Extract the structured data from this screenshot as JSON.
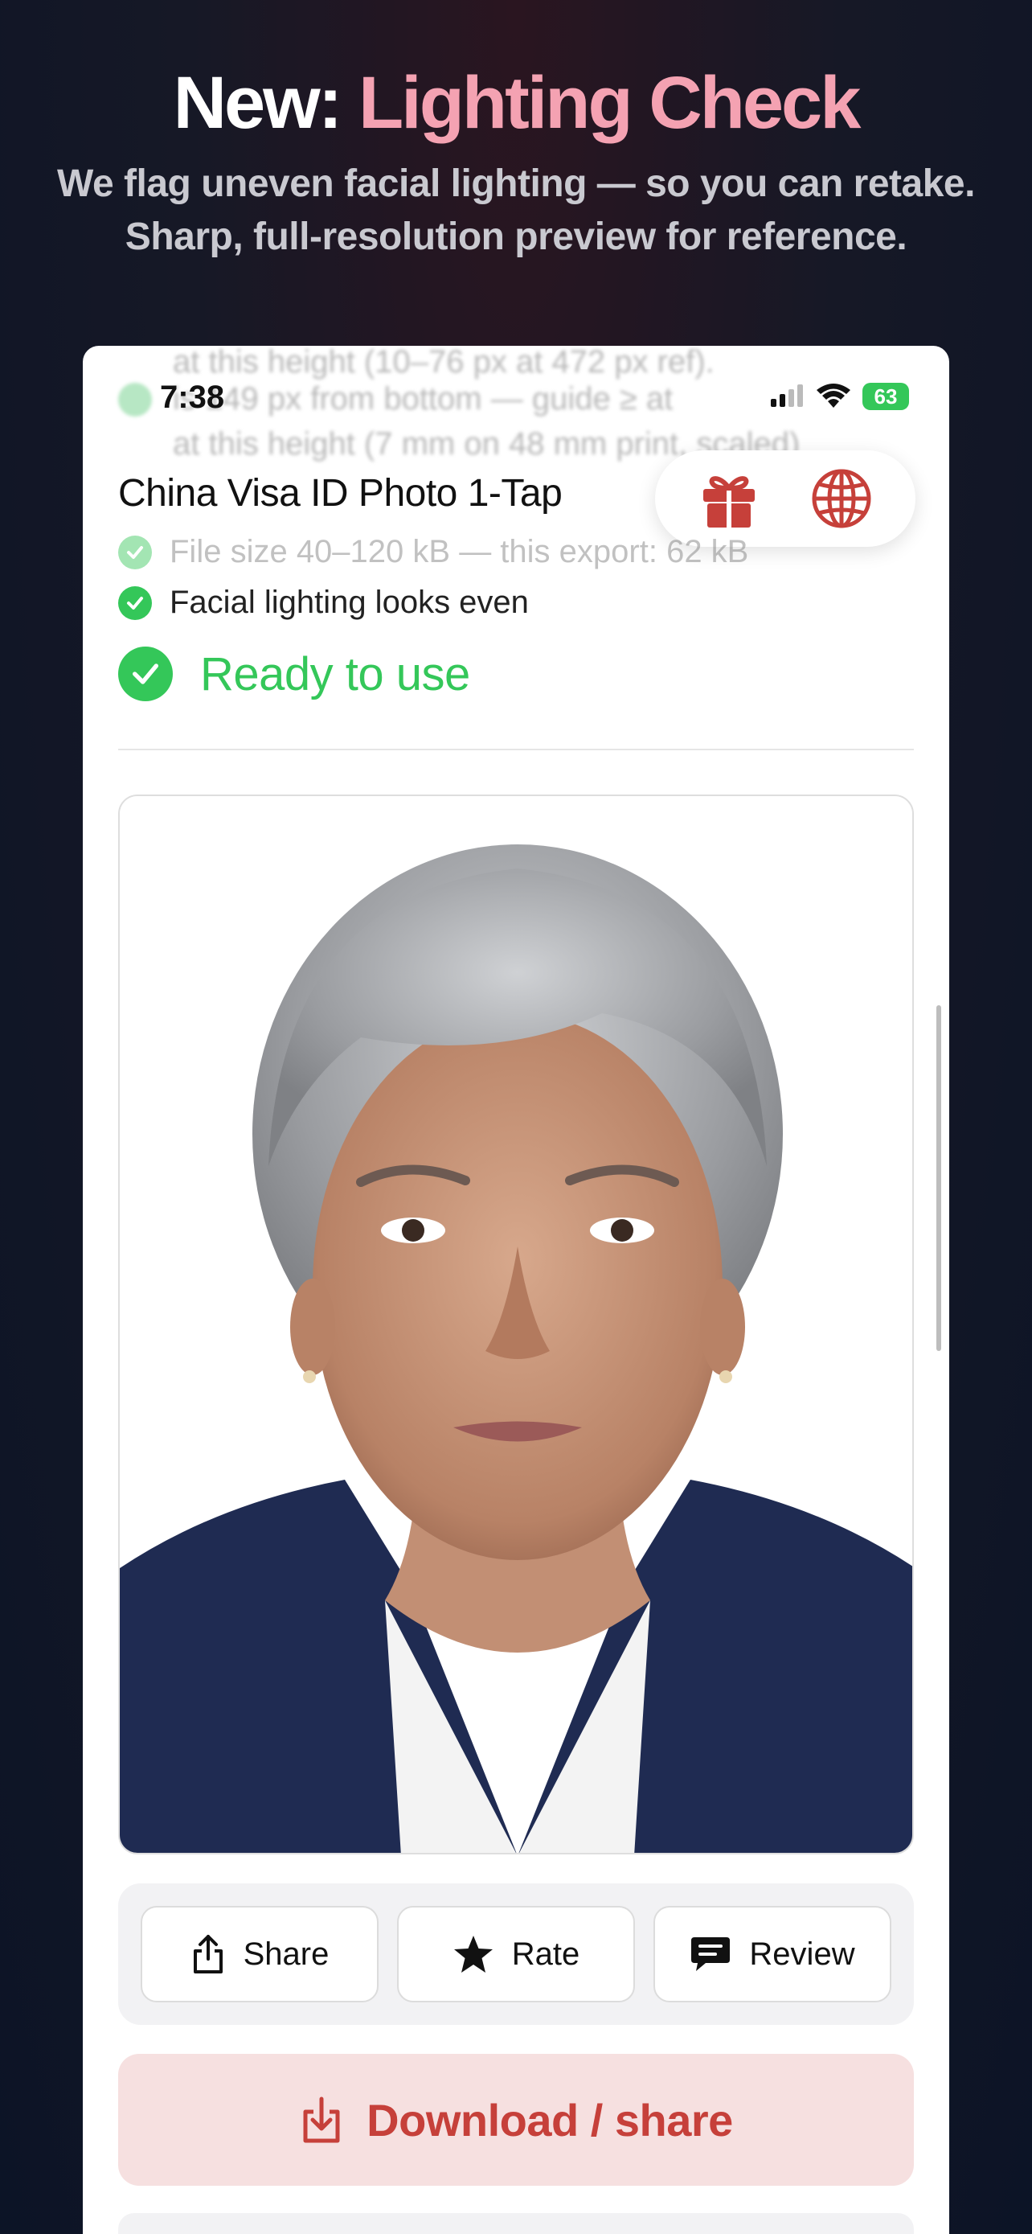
{
  "promo": {
    "title_lead": "New:",
    "title_accent": "Lighting Check",
    "subtitle_line1": "We flag uneven facial lighting — so you can retake.",
    "subtitle_line2": "Sharp, full-resolution preview for reference."
  },
  "status_bar": {
    "time": "7:38",
    "battery": "63"
  },
  "header": {
    "title": "China Visa ID Photo 1-Tap",
    "gift_icon": "gift-icon",
    "globe_icon": "globe-icon"
  },
  "blurred_checks": {
    "line1": "at this height (10–76 px at 472 px ref).",
    "line2": "is 149 px from bottom — guide ≥ at",
    "line3": "at this height (7 mm on 48 mm print, scaled)"
  },
  "checks": [
    {
      "label": "File size 40–120 kB — this export: 62 kB"
    },
    {
      "label": "Facial lighting looks even"
    }
  ],
  "status": {
    "ready_label": "Ready to use"
  },
  "actions": {
    "share": "Share",
    "rate": "Rate",
    "review": "Review"
  },
  "download": {
    "label": "Download / share"
  },
  "colors": {
    "accent_pink": "#f4a2b2",
    "success_green": "#34c759",
    "download_red": "#c6403a",
    "download_bg": "#f6e0e0"
  }
}
